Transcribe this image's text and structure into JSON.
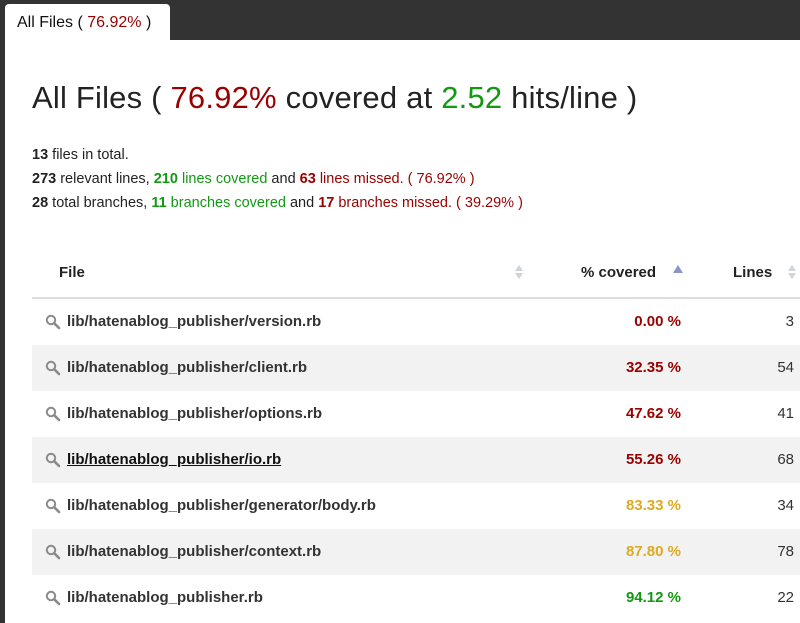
{
  "tab": {
    "label_prefix": "All Files ( ",
    "percent": "76.92%",
    "label_suffix": " )"
  },
  "heading": {
    "prefix": "All Files ( ",
    "percent": "76.92%",
    "middle": " covered at ",
    "hits": "2.52",
    "suffix": " hits/line )"
  },
  "summary": {
    "files_count": "13",
    "files_text": " files in total.",
    "relevant_count": "273",
    "relevant_text": " relevant lines, ",
    "covered_count": "210",
    "covered_text": " lines covered",
    "and1": " and ",
    "missed_count": "63",
    "missed_text": " lines missed.",
    "lines_pct": " ( 76.92% )",
    "branches_count": "28",
    "branches_text": " total branches, ",
    "branches_covered_count": "11",
    "branches_covered_text": " branches covered",
    "and2": " and ",
    "branches_missed_count": "17",
    "branches_missed_text": " branches missed.",
    "branches_pct": " ( 39.29% )"
  },
  "table": {
    "headers": {
      "file": "File",
      "covered": "% covered",
      "lines": "Lines"
    },
    "rows": [
      {
        "file": "lib/hatenablog_publisher/version.rb",
        "covered": "0.00 %",
        "lines": "3",
        "level": "red"
      },
      {
        "file": "lib/hatenablog_publisher/client.rb",
        "covered": "32.35 %",
        "lines": "54",
        "level": "red"
      },
      {
        "file": "lib/hatenablog_publisher/options.rb",
        "covered": "47.62 %",
        "lines": "41",
        "level": "red"
      },
      {
        "file": "lib/hatenablog_publisher/io.rb",
        "covered": "55.26 %",
        "lines": "68",
        "level": "red"
      },
      {
        "file": "lib/hatenablog_publisher/generator/body.rb",
        "covered": "83.33 %",
        "lines": "34",
        "level": "amber"
      },
      {
        "file": "lib/hatenablog_publisher/context.rb",
        "covered": "87.80 %",
        "lines": "78",
        "level": "amber"
      },
      {
        "file": "lib/hatenablog_publisher.rb",
        "covered": "94.12 %",
        "lines": "22",
        "level": "green"
      }
    ]
  },
  "colors": {
    "red": "#990000",
    "amber": "#ddaa22",
    "green": "#119911",
    "tabbar": "#333333"
  },
  "icons": {
    "row_icon": "magnifier-icon",
    "sort_icon": "sort-arrows-icon"
  }
}
